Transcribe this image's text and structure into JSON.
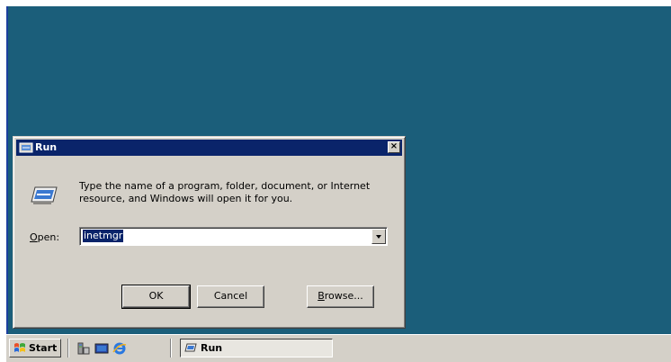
{
  "dialog": {
    "title": "Run",
    "description_line1": "Type the name of a program, folder, document, or Internet",
    "description_line2": "resource, and Windows will open it for you.",
    "open_label_accel": "O",
    "open_label_rest": "pen:",
    "open_value": "inetmgr",
    "close_glyph": "×",
    "ok_label": "OK",
    "cancel_label": "Cancel",
    "browse_accel": "B",
    "browse_rest": "rowse..."
  },
  "taskbar": {
    "start_label": "Start",
    "quick_launch": [
      "server-manager-icon",
      "show-desktop-icon",
      "internet-explorer-icon"
    ],
    "tasks": [
      {
        "label": "Run",
        "icon": "run-icon",
        "active": true
      }
    ]
  },
  "colors": {
    "desktop": "#1b5e7a",
    "titlebar": "#0a246a",
    "face": "#d4d0c8",
    "selection": "#0a246a"
  }
}
